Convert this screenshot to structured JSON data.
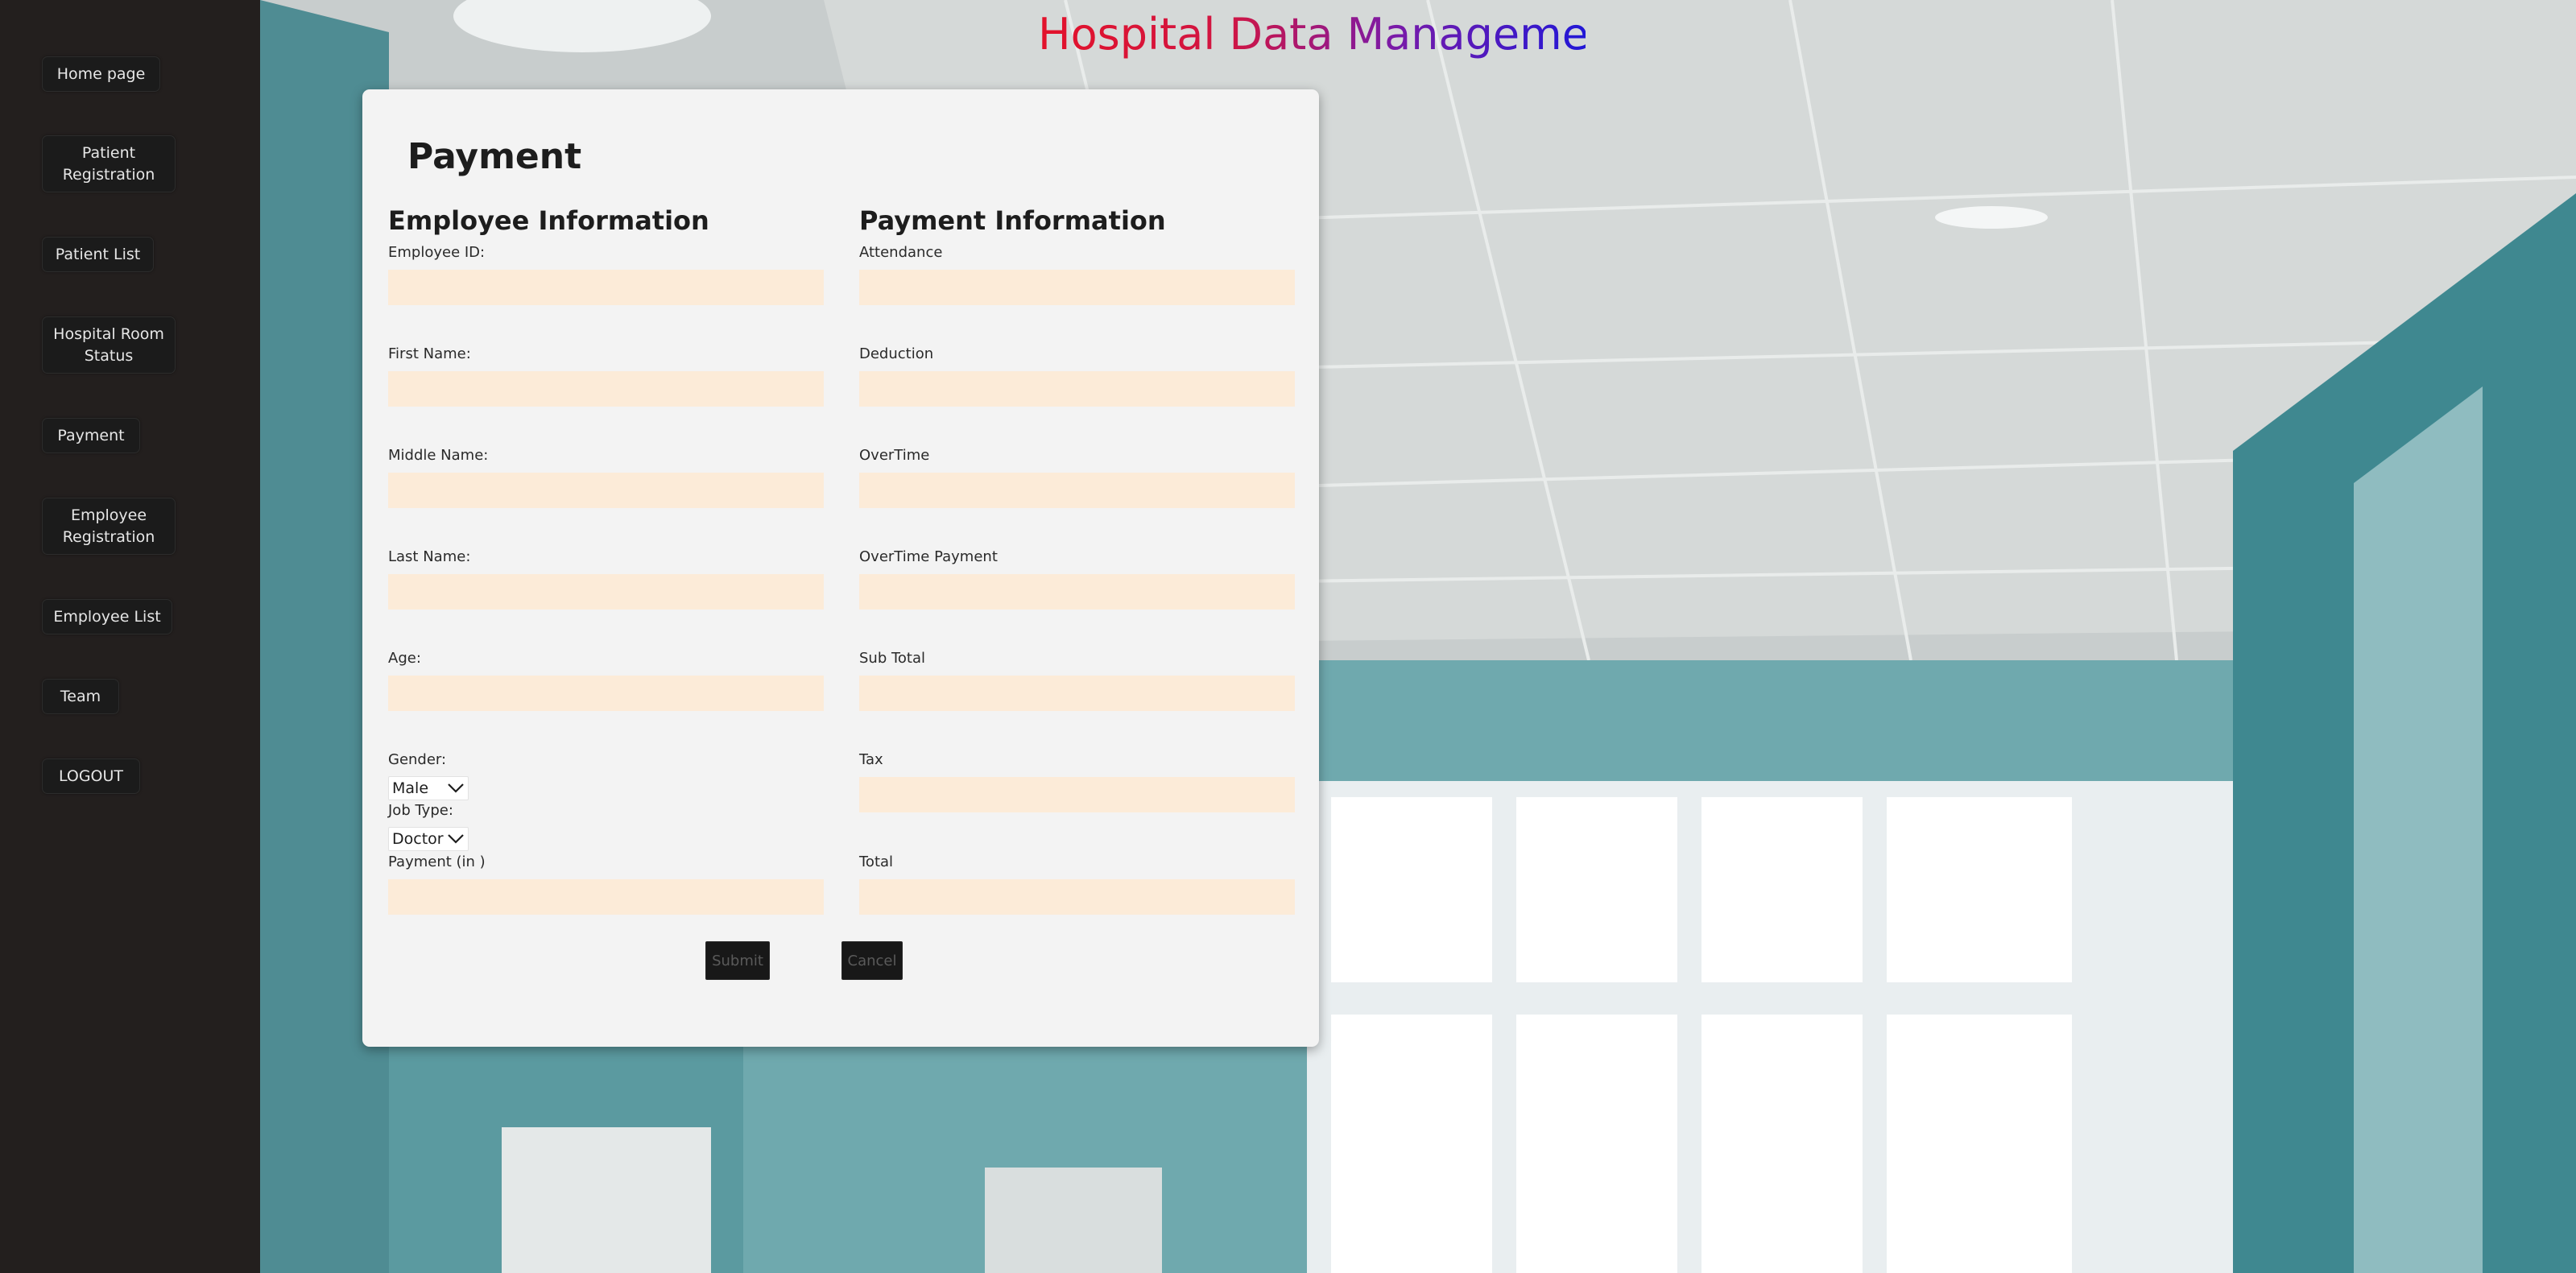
{
  "app": {
    "title": "Hospital Data Management"
  },
  "sidebar": {
    "items": [
      {
        "label": "Home page"
      },
      {
        "label": "Patient Registration"
      },
      {
        "label": "Patient List"
      },
      {
        "label": "Hospital Room Status"
      },
      {
        "label": "Payment"
      },
      {
        "label": "Employee Registration"
      },
      {
        "label": "Employee List"
      },
      {
        "label": "Team"
      },
      {
        "label": "LOGOUT"
      }
    ]
  },
  "form": {
    "title": "Payment",
    "employee_section": {
      "heading": "Employee Information",
      "fields": {
        "employee_id": {
          "label": "Employee ID:",
          "value": ""
        },
        "first_name": {
          "label": "First Name:",
          "value": ""
        },
        "middle_name": {
          "label": "Middle Name:",
          "value": ""
        },
        "last_name": {
          "label": "Last Name:",
          "value": ""
        },
        "age": {
          "label": "Age:",
          "value": ""
        },
        "gender": {
          "label": "Gender:",
          "selected": "Male"
        },
        "job_type": {
          "label": "Job Type:",
          "selected": "Doctor"
        },
        "payment": {
          "label": "Payment (in )",
          "value": ""
        }
      }
    },
    "payment_section": {
      "heading": "Payment Information",
      "fields": {
        "attendance": {
          "label": "Attendance",
          "value": ""
        },
        "deduction": {
          "label": "Deduction",
          "value": ""
        },
        "overtime": {
          "label": "OverTime",
          "value": ""
        },
        "overtime_payment": {
          "label": "OverTime Payment",
          "value": ""
        },
        "sub_total": {
          "label": "Sub Total",
          "value": ""
        },
        "tax": {
          "label": "Tax",
          "value": ""
        },
        "total": {
          "label": "Total",
          "value": ""
        }
      }
    },
    "buttons": {
      "submit": "Submit",
      "cancel": "Cancel"
    }
  },
  "colors": {
    "sidebar_bg": "#231f1e",
    "card_bg": "#f3f3f3",
    "input_bg": "#fcebd8",
    "title_gradient_start": "#e3122a",
    "title_gradient_end": "#2218d6"
  },
  "icons": {
    "select_chevron": "chevron-down-icon"
  }
}
